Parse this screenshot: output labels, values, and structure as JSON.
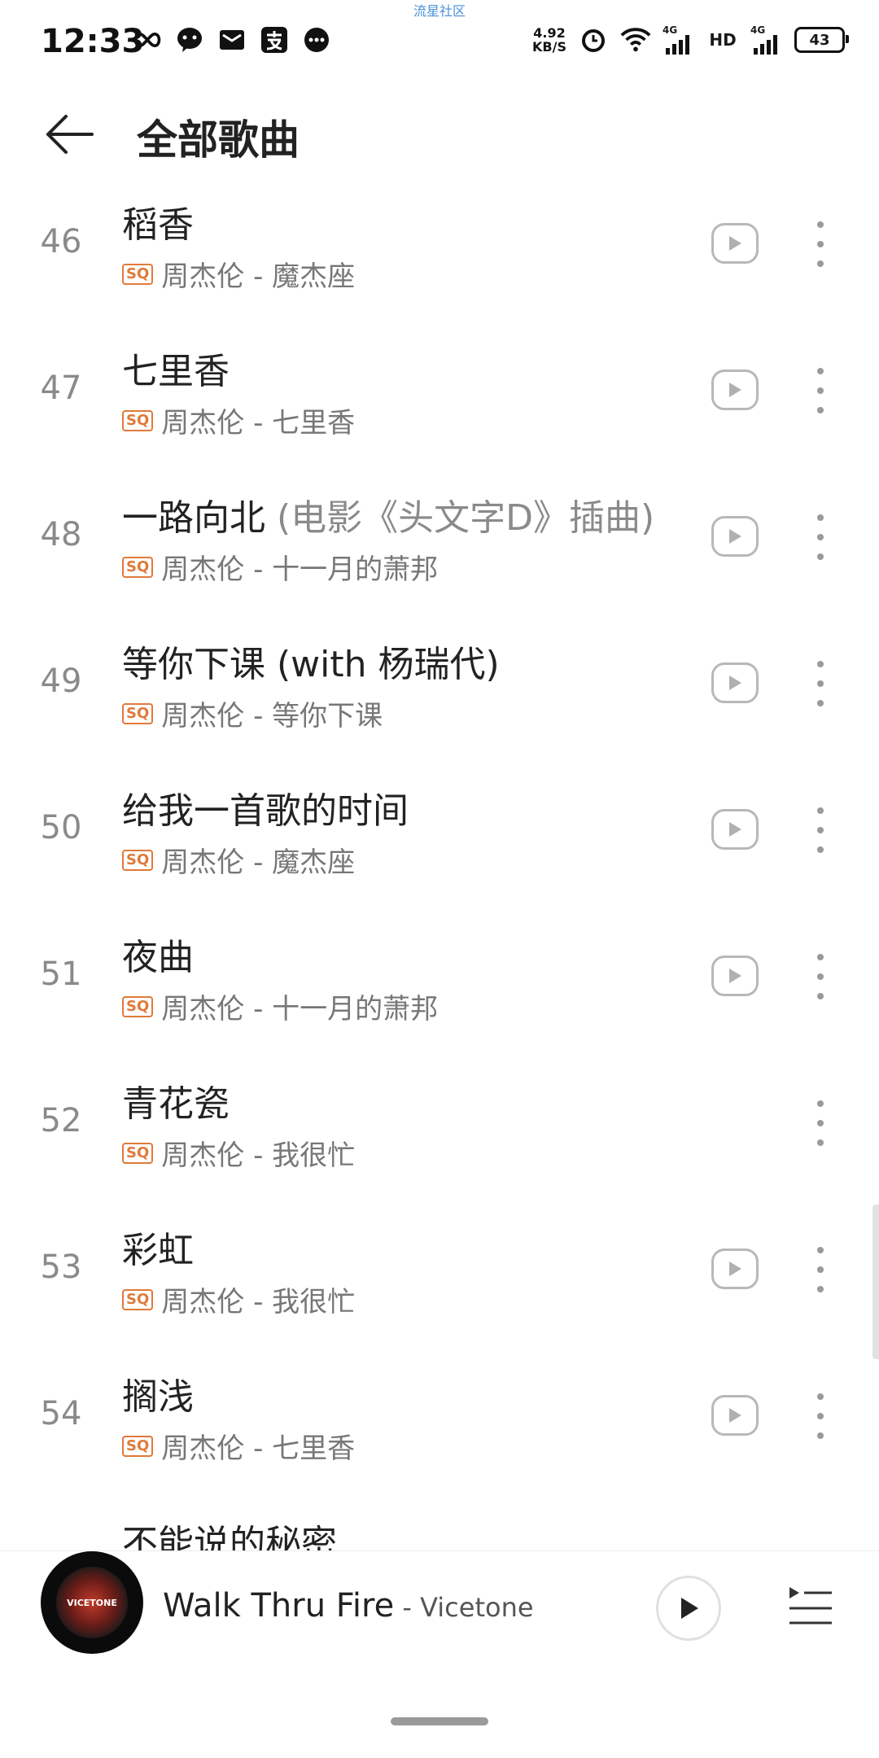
{
  "status_bar": {
    "time": "12:33",
    "watermark": "流星社区",
    "net_speed_value": "4.92",
    "net_speed_unit": "KB/S",
    "signal_1": "4G",
    "hd": "HD",
    "signal_2": "4G",
    "battery": "43"
  },
  "header": {
    "title": "全部歌曲"
  },
  "songs": [
    {
      "index": "46",
      "title": "稻香",
      "subtitle": "",
      "quality": "SQ",
      "meta": "周杰伦 - 魔杰座",
      "playable": true
    },
    {
      "index": "47",
      "title": "七里香",
      "subtitle": "",
      "quality": "SQ",
      "meta": "周杰伦 - 七里香",
      "playable": true
    },
    {
      "index": "48",
      "title": "一路向北",
      "subtitle": "(电影《头文字D》插曲)",
      "quality": "SQ",
      "meta": "周杰伦 - 十一月的萧邦",
      "playable": true
    },
    {
      "index": "49",
      "title": "等你下课 (with 杨瑞代)",
      "subtitle": "",
      "quality": "SQ",
      "meta": "周杰伦 - 等你下课",
      "playable": true
    },
    {
      "index": "50",
      "title": "给我一首歌的时间",
      "subtitle": "",
      "quality": "SQ",
      "meta": "周杰伦 - 魔杰座",
      "playable": true
    },
    {
      "index": "51",
      "title": "夜曲",
      "subtitle": "",
      "quality": "SQ",
      "meta": "周杰伦 - 十一月的萧邦",
      "playable": true
    },
    {
      "index": "52",
      "title": "青花瓷",
      "subtitle": "",
      "quality": "SQ",
      "meta": "周杰伦 - 我很忙",
      "playable": false
    },
    {
      "index": "53",
      "title": "彩虹",
      "subtitle": "",
      "quality": "SQ",
      "meta": "周杰伦 - 我很忙",
      "playable": true
    },
    {
      "index": "54",
      "title": "搁浅",
      "subtitle": "",
      "quality": "SQ",
      "meta": "周杰伦 - 七里香",
      "playable": true
    },
    {
      "index": "",
      "title": "不能说的秘密",
      "subtitle": "",
      "quality": "",
      "meta": "",
      "playable": true
    }
  ],
  "player": {
    "album_text": "VICETONE",
    "title": "Walk Thru Fire",
    "separator": " - ",
    "artist": "Vicetone"
  },
  "colors": {
    "accent_sq": "#e07a3a",
    "text_primary": "#222222",
    "text_secondary": "#777777"
  }
}
